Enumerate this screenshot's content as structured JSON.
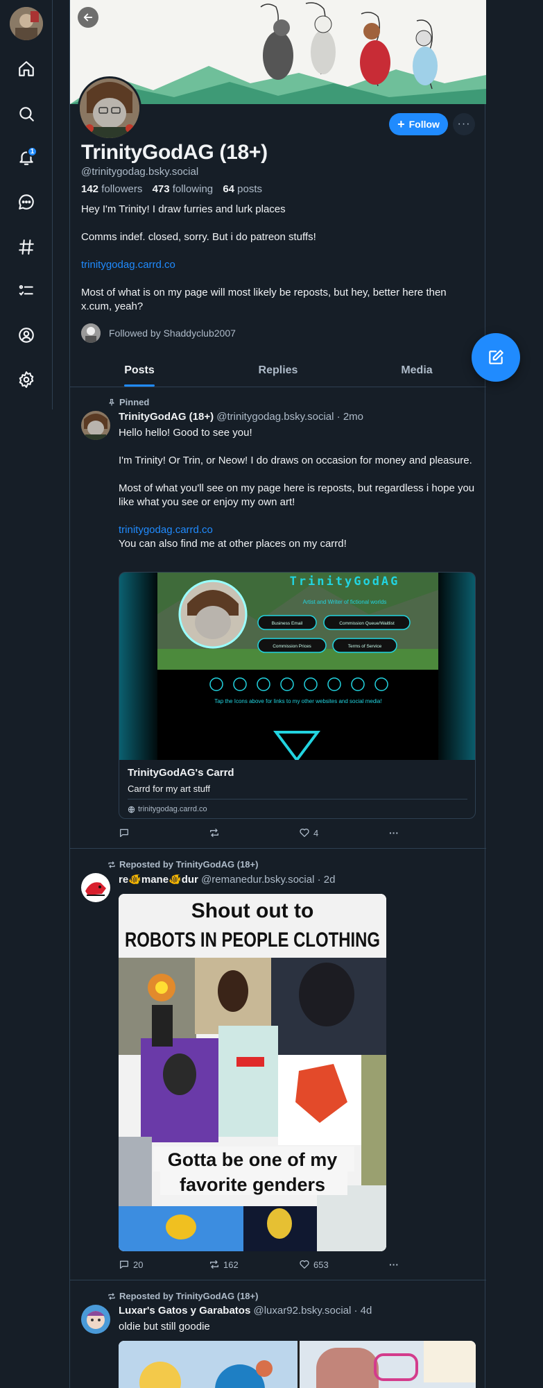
{
  "profile": {
    "display_name": "TrinityGodAG (18+)",
    "handle": "@trinitygodag.bsky.social",
    "followers_count": "142",
    "followers_label": "followers",
    "following_count": "473",
    "following_label": "following",
    "posts_count": "64",
    "posts_label": "posts",
    "bio_line1": "Hey I'm Trinity! I draw furries and lurk places",
    "bio_line2": "Comms indef. closed, sorry. But i do patreon stuffs!",
    "bio_link": "trinitygodag.carrd.co",
    "bio_line3": "Most of what is on my page will most likely be reposts, but hey, better here then x.cum, yeah?",
    "followed_by": "Followed by Shaddyclub2007",
    "follow_label": "Follow",
    "more_label": "···"
  },
  "nav": {
    "notification_badge": "1",
    "icons": [
      "home-icon",
      "search-icon",
      "bell-icon",
      "chat-icon",
      "hashtag-icon",
      "list-icon",
      "profile-icon",
      "settings-icon"
    ]
  },
  "tabs": [
    "Posts",
    "Replies",
    "Media"
  ],
  "posts": [
    {
      "pinned_label": "Pinned",
      "author": "TrinityGodAG (18+)",
      "handle": "@trinitygodag.bsky.social",
      "time": "· 2mo",
      "p1": "Hello hello! Good to see you!",
      "p2": "I'm Trinity! Or Trin, or Neow! I do draws on occasion for money and pleasure.",
      "p3": "Most of what you'll see on my page here is reposts, but regardless i hope you like what you see or enjoy my own art!",
      "link": "trinitygodag.carrd.co",
      "p4": "You can also find me at other places on my carrd!",
      "card": {
        "image_title": "TrinityGodAG",
        "image_subtitle": "Artist and Writer of fictional worlds",
        "btn1": "Business Email",
        "btn2": "Commission Queue/Waitlist",
        "btn3": "Commission Prices",
        "btn4": "Terms of Service",
        "tap_text": "Tap the Icons above for links to my other websites and social media!",
        "title": "TrinityGodAG's Carrd",
        "description": "Carrd for my art stuff",
        "url": "trinitygodag.carrd.co"
      },
      "replies": "",
      "reposts": "",
      "likes": "4"
    },
    {
      "repost_label": "Reposted by TrinityGodAG (18+)",
      "author": "re🐠mane🐠dur",
      "handle": "@remanedur.bsky.social",
      "time": "· 2d",
      "image_top_1": "Shout out to",
      "image_top_2": "ROBOTS IN PEOPLE CLOTHING",
      "image_bottom_1": "Gotta be one of my",
      "image_bottom_2": "favorite genders",
      "replies": "20",
      "reposts": "162",
      "likes": "653"
    },
    {
      "repost_label": "Reposted by TrinityGodAG (18+)",
      "author": "Luxar's Gatos y Garabatos",
      "handle": "@luxar92.bsky.social",
      "time": "· 4d",
      "text": "oldie but still goodie"
    }
  ],
  "colors": {
    "background": "#161e27",
    "accent": "#208bfe",
    "border": "#2e4052",
    "text_muted": "#aebbc9"
  }
}
